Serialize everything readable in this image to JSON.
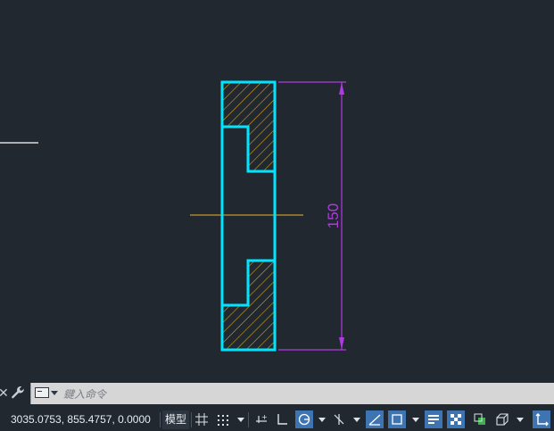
{
  "drawing": {
    "dimension_label": "150",
    "colors": {
      "background": "#212830",
      "outline": "#00e5ff",
      "hatch": "#d4a017",
      "dimension": "#b03ae0",
      "centerline": "#c8962a",
      "line": "#ffffff"
    }
  },
  "command_line": {
    "placeholder": "鍵入命令",
    "tool_icons": [
      "close-icon",
      "wrench-icon"
    ]
  },
  "status_bar": {
    "coordinates": "3035.0753, 855.4757, 0.0000",
    "model_label": "模型",
    "icons": [
      "grid-icon",
      "snap-icon",
      "infer-icon",
      "ortho-icon",
      "polar-icon",
      "isodraft-icon",
      "object-track-icon",
      "object-snap-icon",
      "lineweight-icon",
      "transparency-icon",
      "selection-cycling-icon",
      "3d-osnap-icon",
      "ucs-icon"
    ]
  }
}
